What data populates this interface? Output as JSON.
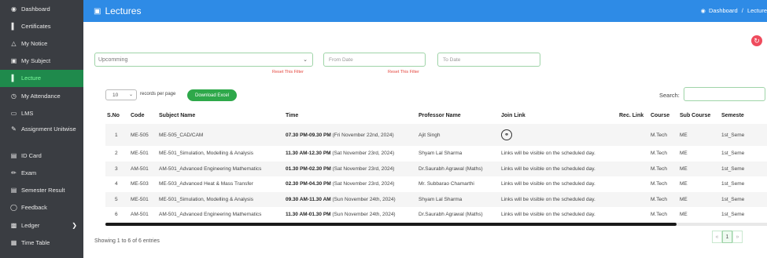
{
  "sidebar": {
    "items": [
      {
        "label": "Dashboard",
        "icon": "palette-icon"
      },
      {
        "label": "Certificates",
        "icon": "book-icon"
      },
      {
        "label": "My Notice",
        "icon": "bell-icon"
      },
      {
        "label": "My Subject",
        "icon": "book-icon"
      },
      {
        "label": "Lecture",
        "icon": "book-icon"
      },
      {
        "label": "My Attendance",
        "icon": "clock-icon"
      },
      {
        "label": "LMS",
        "icon": "monitor-icon"
      },
      {
        "label": "Assignment Unitwise",
        "icon": "edit-icon"
      },
      {
        "label": "ID Card",
        "icon": "id-card-icon"
      },
      {
        "label": "Exam",
        "icon": "pencil-icon"
      },
      {
        "label": "Semester Result",
        "icon": "list-icon"
      },
      {
        "label": "Feedback",
        "icon": "chat-icon"
      },
      {
        "label": "Ledger",
        "icon": "ledger-icon"
      },
      {
        "label": "Time Table",
        "icon": "table-icon"
      }
    ],
    "active_index": 4
  },
  "header": {
    "title": "Lectures",
    "breadcrumb_home": "Dashboard",
    "breadcrumb_sep": "/",
    "breadcrumb_current": "Lecture"
  },
  "filters": {
    "status_value": "Upcomming",
    "reset_label": "Reset This Filter",
    "from_placeholder": "From Date",
    "to_placeholder": "To Date"
  },
  "toolbar": {
    "page_length": "10",
    "records_label": "records per page",
    "excel_label": "Download Excel",
    "search_label": "Search:"
  },
  "table": {
    "headers": [
      "S.No",
      "Code",
      "Subject Name",
      "Time",
      "Professor Name",
      "Join Link",
      "Rec. Link",
      "Course",
      "Sub Course",
      "Semeste"
    ],
    "rows": [
      {
        "sno": "1",
        "code": "ME-505",
        "subject": "ME-505_CAD/CAM",
        "time_bold": "07.30 PM-09.30 PM",
        "time_rest": " (Fri November 22nd, 2024)",
        "professor": "Ajit Singh",
        "join": "",
        "rec": "",
        "course": "M.Tech",
        "sub": "ME",
        "sem": "1st_Seme"
      },
      {
        "sno": "2",
        "code": "ME-501",
        "subject": "ME-501_Simulation, Modelling & Analysis",
        "time_bold": "11.30 AM-12.30 PM",
        "time_rest": " (Sat November 23rd, 2024)",
        "professor": "Shyam Lal Sharma",
        "join": "Links will be visible on the scheduled day.",
        "rec": "",
        "course": "M.Tech",
        "sub": "ME",
        "sem": "1st_Seme"
      },
      {
        "sno": "3",
        "code": "AM-501",
        "subject": "AM-501_Advanced Engineering Mathematics",
        "time_bold": "01.30 PM-02.30 PM",
        "time_rest": " (Sat November 23rd, 2024)",
        "professor": "Dr.Saurabh Agrawal (Maths)",
        "join": "Links will be visible on the scheduled day.",
        "rec": "",
        "course": "M.Tech",
        "sub": "ME",
        "sem": "1st_Seme"
      },
      {
        "sno": "4",
        "code": "ME-503",
        "subject": "ME-503_Advanced Heat & Mass Transfer",
        "time_bold": "02.30 PM-04.30 PM",
        "time_rest": " (Sat November 23rd, 2024)",
        "professor": "Mr. Subbarao Chamarthi",
        "join": "Links will be visible on the scheduled day.",
        "rec": "",
        "course": "M.Tech",
        "sub": "ME",
        "sem": "1st_Seme"
      },
      {
        "sno": "5",
        "code": "ME-501",
        "subject": "ME-501_Simulation, Modelling & Analysis",
        "time_bold": "09.30 AM-11.30 AM",
        "time_rest": " (Sun November 24th, 2024)",
        "professor": "Shyam Lal Sharma",
        "join": "Links will be visible on the scheduled day.",
        "rec": "",
        "course": "M.Tech",
        "sub": "ME",
        "sem": "1st_Seme"
      },
      {
        "sno": "6",
        "code": "AM-501",
        "subject": "AM-501_Advanced Engineering Mathematics",
        "time_bold": "11.30 AM-01.30 PM",
        "time_rest": " (Sun November 24th, 2024)",
        "professor": "Dr.Saurabh Agrawal (Maths)",
        "join": "Links will be visible on the scheduled day.",
        "rec": "",
        "course": "M.Tech",
        "sub": "ME",
        "sem": "1st_Seme"
      }
    ]
  },
  "footer": {
    "showing": "Showing 1 to 6 of 6 entries",
    "prev": "«",
    "current_page": "1",
    "next": "»"
  },
  "colors": {
    "sidebar_bg": "#3a3d42",
    "active_bg": "#1f8a4c",
    "header_bg": "#2e8be6",
    "excel_green": "#2ea84a",
    "refresh_red": "#ef4b5d"
  }
}
